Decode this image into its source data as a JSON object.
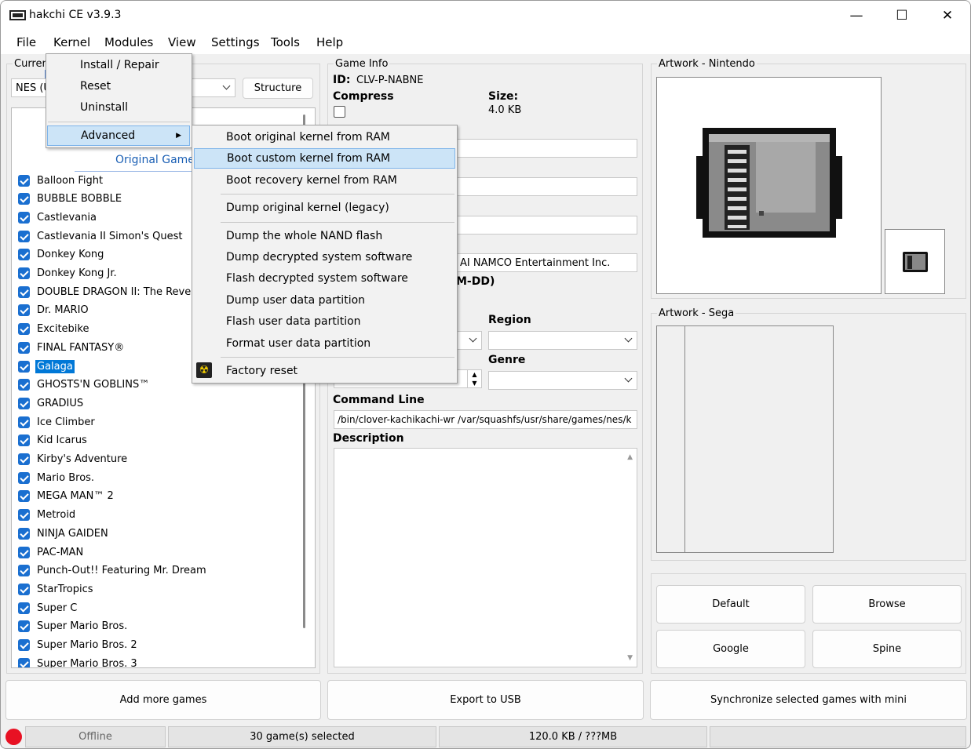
{
  "window": {
    "title": "hakchi CE v3.9.3",
    "minimize": "—",
    "maximize": "☐",
    "close": "✕"
  },
  "menubar": [
    "File",
    "Kernel",
    "Modules",
    "View",
    "Settings",
    "Tools",
    "Help"
  ],
  "left": {
    "group_label": "Curren",
    "console_select": "NES (U",
    "structure_button": "Structure",
    "list_header": "Original Game",
    "games": [
      "Balloon Fight",
      "BUBBLE BOBBLE",
      "Castlevania",
      "Castlevania II Simon's Quest",
      "Donkey Kong",
      "Donkey Kong Jr.",
      "DOUBLE DRAGON II: The Reveng",
      "Dr. MARIO",
      "Excitebike",
      "FINAL FANTASY®",
      "Galaga",
      "GHOSTS'N GOBLINS™",
      "GRADIUS",
      "Ice Climber",
      "Kid Icarus",
      "Kirby's Adventure",
      "Mario Bros.",
      "MEGA MAN™ 2",
      "Metroid",
      "NINJA GAIDEN",
      "PAC-MAN",
      "Punch-Out!! Featuring Mr. Dream",
      "StarTropics",
      "Super C",
      "Super Mario Bros.",
      "Super Mario Bros. 2",
      "Super Mario Bros. 3"
    ],
    "selected_game": "Galaga"
  },
  "game_info": {
    "group_label": "Game Info",
    "id_label": "ID:",
    "id_value": "CLV-P-NABNE",
    "compress_label": "Compress",
    "size_label": "Size:",
    "size_value": "4.0 KB",
    "publisher_value": "AI NAMCO Entertainment Inc.",
    "date_fragment": "M-DD)",
    "region_label": "Region",
    "genre_label": "Genre",
    "command_line_label": "Command Line",
    "command_line_value": "/bin/clover-kachikachi-wr /var/squashfs/usr/share/games/nes/k",
    "description_label": "Description"
  },
  "artwork": {
    "nintendo_label": "Artwork - Nintendo",
    "sega_label": "Artwork - Sega",
    "buttons": {
      "default": "Default",
      "browse": "Browse",
      "google": "Google",
      "spine": "Spine"
    }
  },
  "bottom_buttons": {
    "add": "Add more games",
    "export": "Export to USB",
    "sync": "Synchronize selected games with mini"
  },
  "status": {
    "connection": "Offline",
    "selected": "30 game(s) selected",
    "size": "120.0 KB / ???MB",
    "indicator_color": "#e81123"
  },
  "kernel_menu": {
    "items": [
      "Install / Repair",
      "Reset",
      "Uninstall"
    ],
    "advanced": "Advanced"
  },
  "advanced_menu": {
    "group1": [
      "Boot original kernel from RAM",
      "Boot custom kernel from RAM",
      "Boot recovery kernel from RAM"
    ],
    "group2": [
      "Dump original kernel (legacy)"
    ],
    "group3": [
      "Dump the whole NAND flash",
      "Dump decrypted system software",
      "Flash decrypted system software",
      "Dump user data partition",
      "Flash user data partition",
      "Format user data partition"
    ],
    "group4": [
      "Factory reset"
    ],
    "highlighted": "Boot custom kernel from RAM"
  },
  "colors": {
    "accent": "#0078d7",
    "menu_highlight": "#cce4f7",
    "link_blue": "#1a5fb4"
  }
}
